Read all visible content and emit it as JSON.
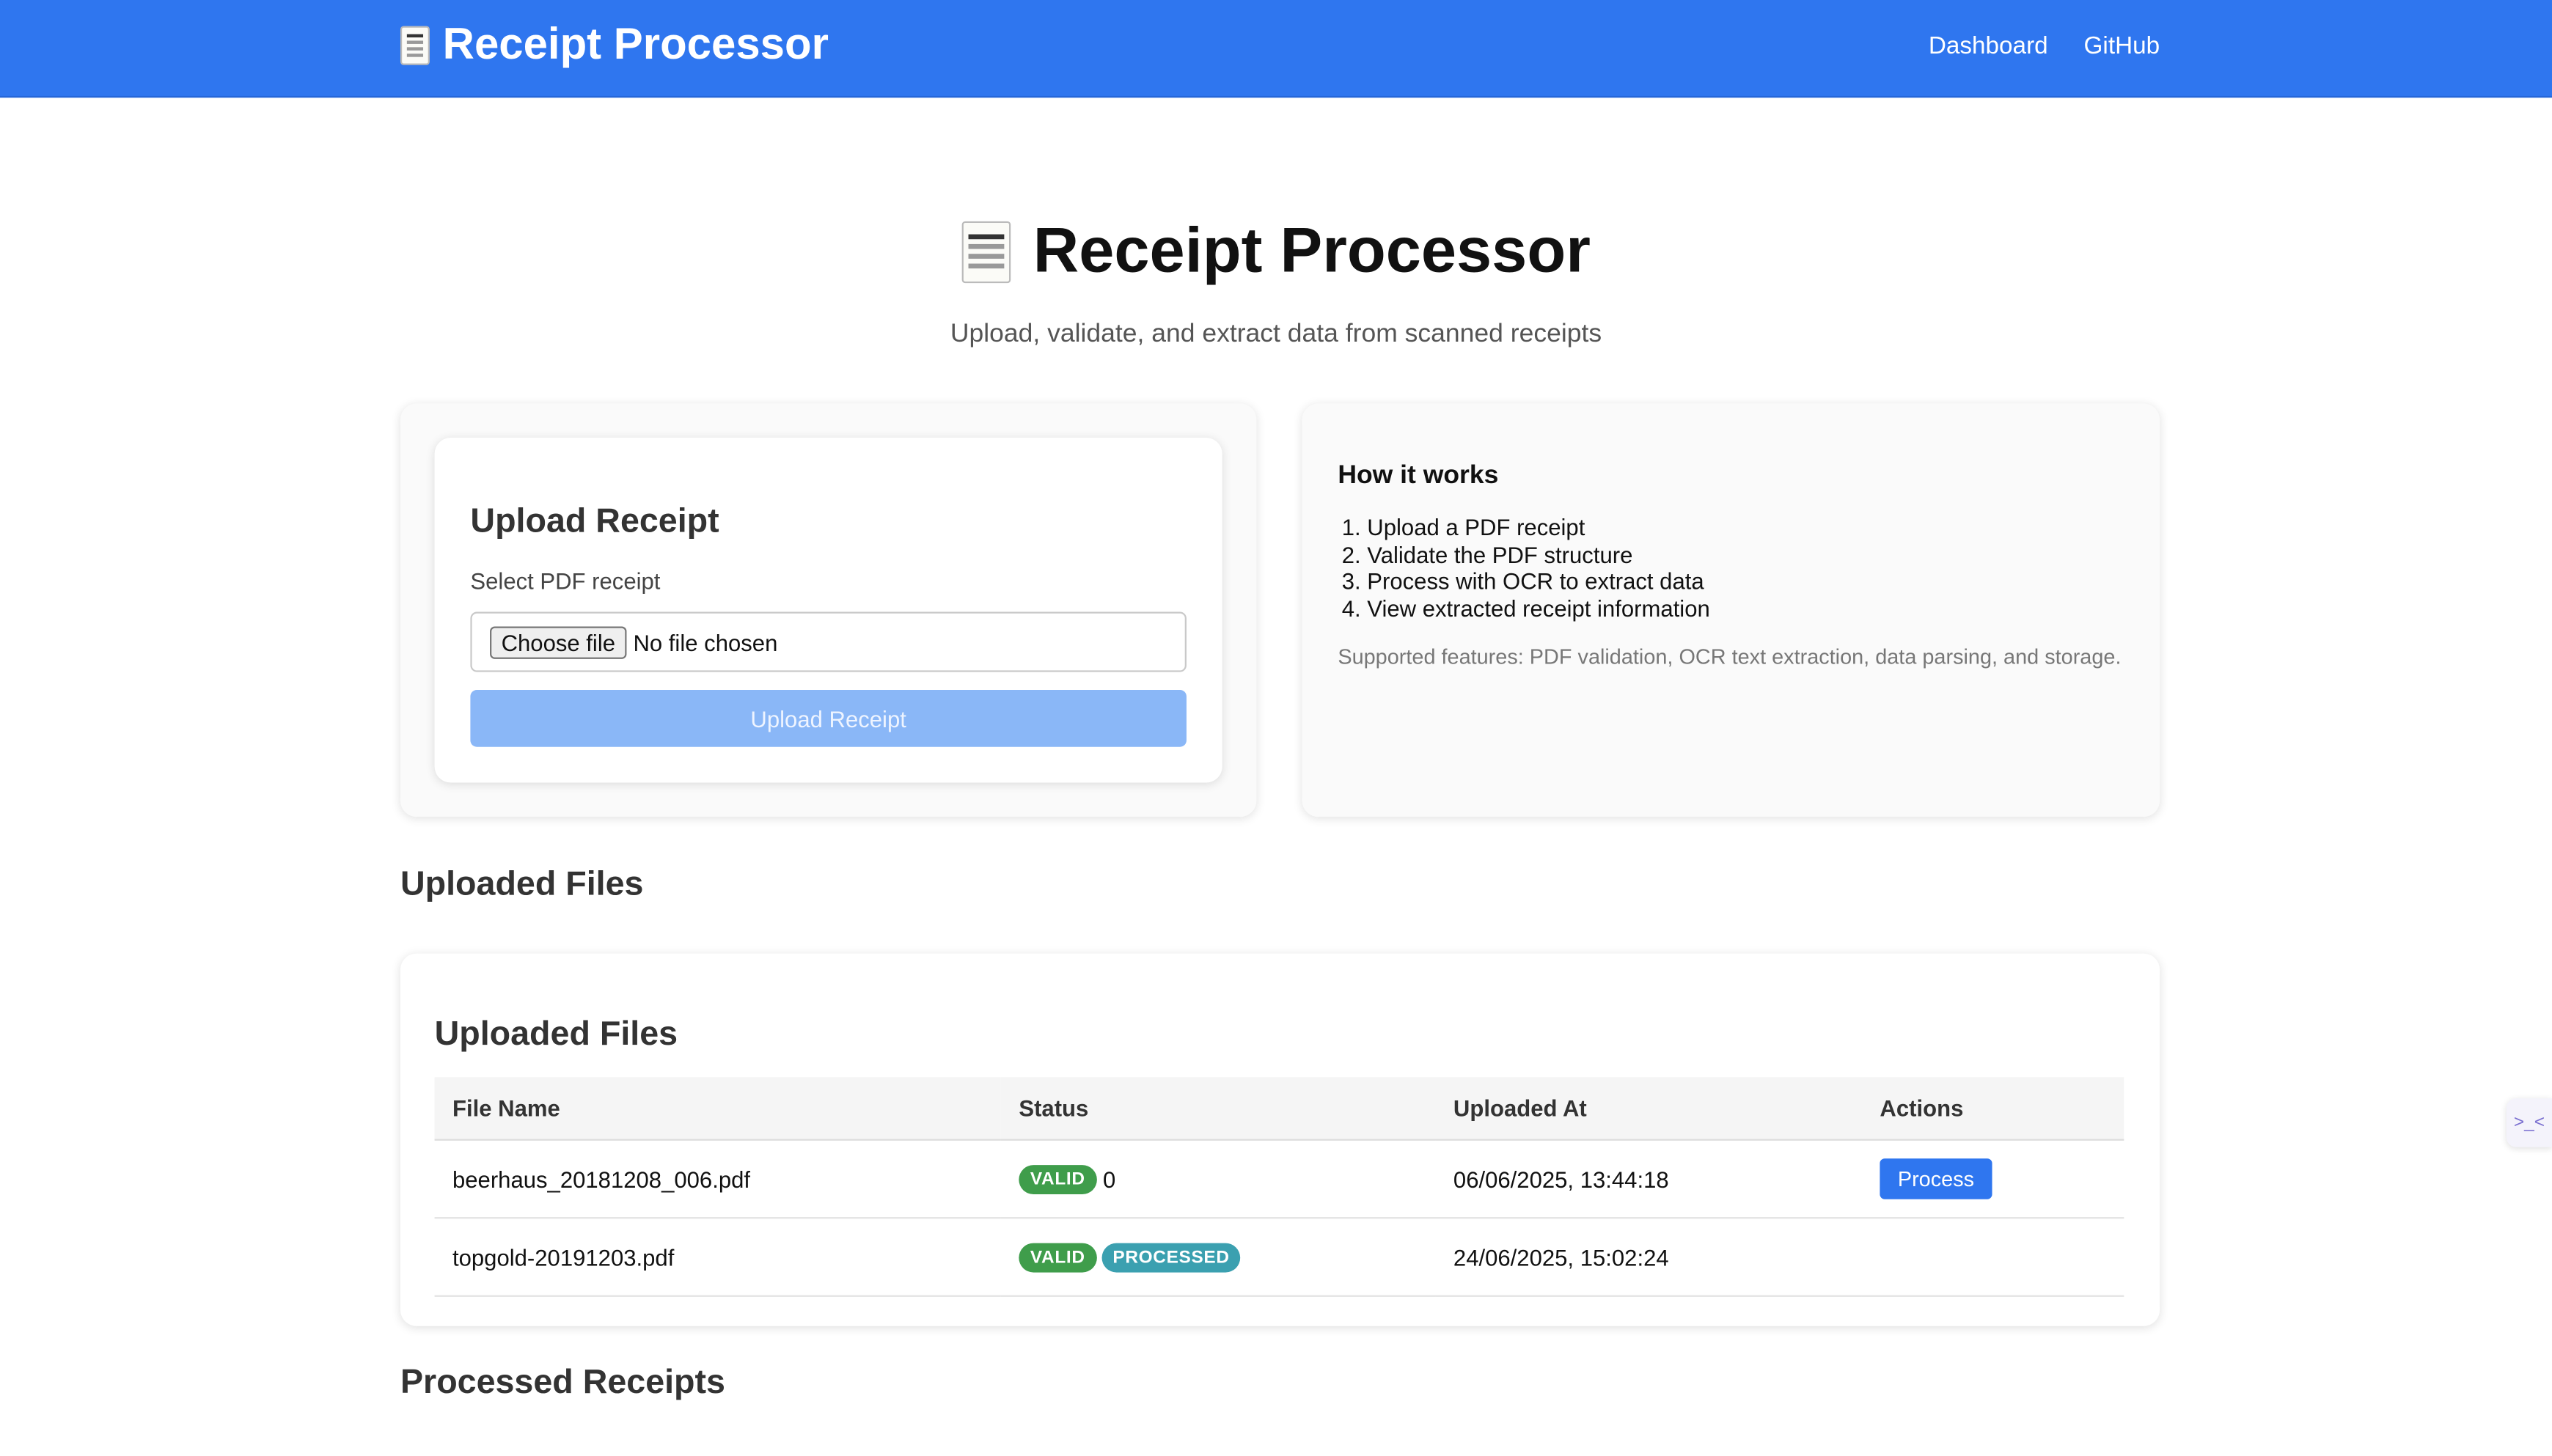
{
  "navbar": {
    "brand": "Receipt Processor",
    "links": [
      "Dashboard",
      "GitHub"
    ]
  },
  "hero": {
    "title": "Receipt Processor",
    "subtitle": "Upload, validate, and extract data from scanned receipts"
  },
  "upload": {
    "title": "Upload Receipt",
    "field_label": "Select PDF receipt",
    "choose_label": "Choose file",
    "file_status": "No file chosen",
    "submit_label": "Upload Receipt"
  },
  "how_it_works": {
    "title": "How it works",
    "steps": [
      "Upload a PDF receipt",
      "Validate the PDF structure",
      "Process with OCR to extract data",
      "View extracted receipt information"
    ],
    "features": "Supported features: PDF validation, OCR text extraction, data parsing, and storage."
  },
  "uploaded_section_title": "Uploaded Files",
  "files_table": {
    "title": "Uploaded Files",
    "columns": [
      "File Name",
      "Status",
      "Uploaded At",
      "Actions"
    ],
    "rows": [
      {
        "file_name": "beerhaus_20181208_006.pdf",
        "status_badge": "VALID",
        "status_extra": "0",
        "uploaded_at": "06/06/2025, 13:44:18",
        "action": "Process"
      },
      {
        "file_name": "topgold-20191203.pdf",
        "status_badge": "VALID",
        "status_badge_2": "PROCESSED",
        "uploaded_at": "24/06/2025, 15:02:24"
      }
    ]
  },
  "processed_section_title": "Processed Receipts",
  "side_tab": {
    "label": ">_<"
  },
  "colors": {
    "primary": "#2f76ef",
    "valid": "#3f9d4b",
    "processed": "#3ba0b0",
    "upload_disabled": "#8ab7f7"
  }
}
